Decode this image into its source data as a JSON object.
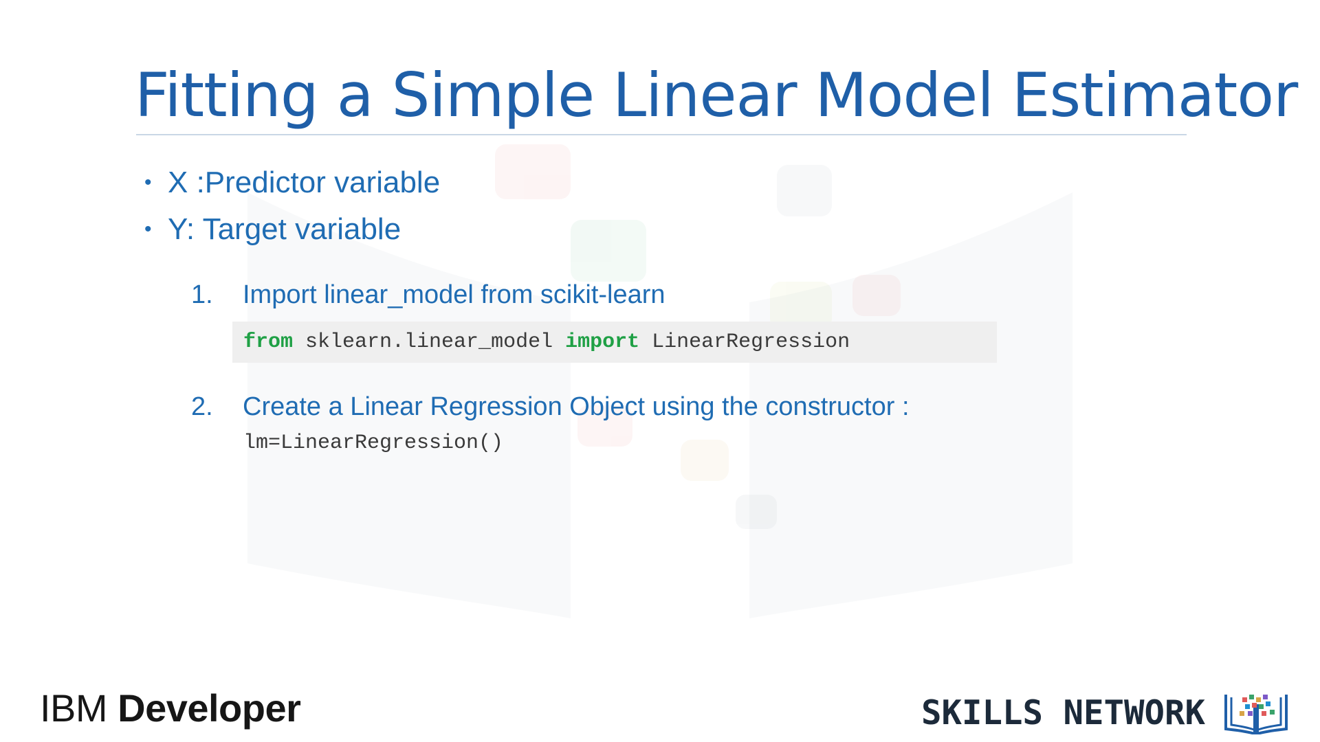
{
  "slide": {
    "title": "Fitting a Simple Linear Model Estimator",
    "bullets": [
      {
        "label": "X :Predictor variable"
      },
      {
        "label": "Y: Target variable"
      }
    ],
    "steps": [
      {
        "number": "1.",
        "text": "Import linear_model from scikit-learn",
        "code": {
          "kw_from": "from",
          "module": " sklearn.linear_model ",
          "kw_import": "import",
          "name": " LinearRegression"
        }
      },
      {
        "number": "2.",
        "text": "Create a Linear Regression Object using the constructor :",
        "code_line": "lm=LinearRegression()"
      }
    ]
  },
  "footer": {
    "ibm_logo_light": "IBM ",
    "ibm_logo_bold": "Developer",
    "skills_network": "SKILLS NETWORK"
  },
  "colors": {
    "title": "#1f5fa8",
    "body_text": "#1f6cb3",
    "code_keyword": "#1fa045",
    "code_text": "#3a3a3a",
    "code_background": "#efefef"
  }
}
